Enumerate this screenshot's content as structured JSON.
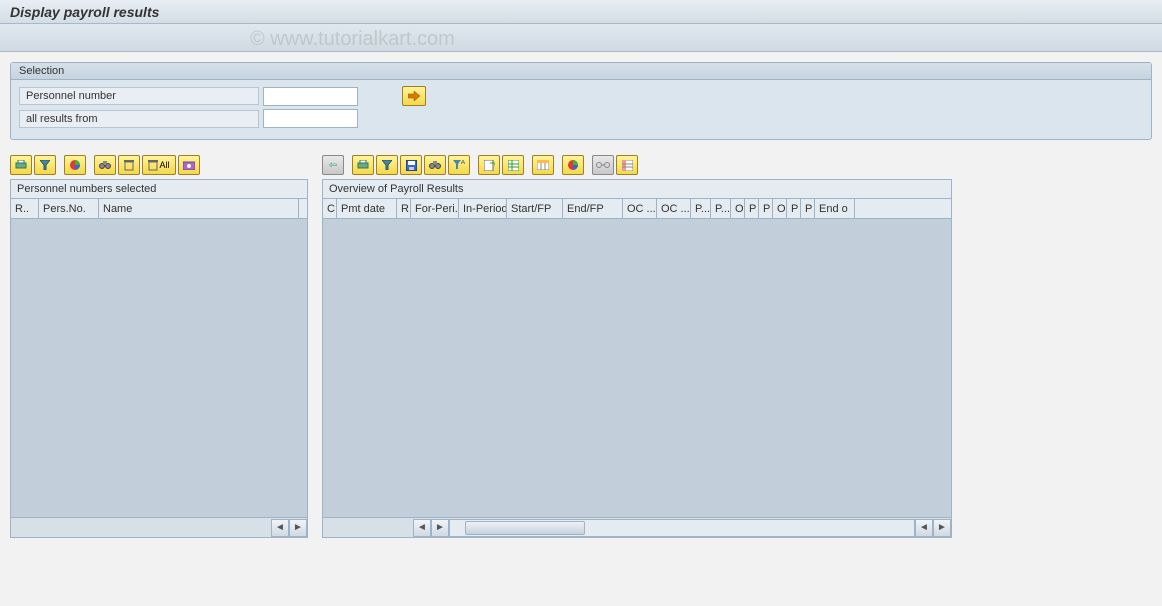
{
  "title": "Display payroll results",
  "watermark": "© www.tutorialkart.com",
  "selection": {
    "header": "Selection",
    "personnel_label": "Personnel number",
    "personnel_value": "",
    "allresults_label": "all results from",
    "allresults_value": ""
  },
  "leftToolbar": {
    "btns": [
      "print",
      "filter",
      "chart",
      "find",
      "delete",
      "delete_all",
      "refresh"
    ],
    "delete_all_label": "All"
  },
  "rightToolbar": {
    "btns": [
      "back",
      "print",
      "filter",
      "save",
      "find",
      "sort_filter",
      "export",
      "spreadsheet",
      "layout",
      "chart",
      "link",
      "settings"
    ]
  },
  "leftGrid": {
    "title": "Personnel numbers selected",
    "columns": [
      "R..",
      "Pers.No.",
      "Name"
    ]
  },
  "rightGrid": {
    "title": "Overview of Payroll Results",
    "columns": [
      "C",
      "Pmt date",
      "R",
      "For-Peri..",
      "In-Period",
      "Start/FP",
      "End/FP",
      "OC ...",
      "OC ...",
      "P...",
      "P...",
      "O",
      "P",
      "P",
      "O",
      "P",
      "P",
      "End o"
    ]
  }
}
